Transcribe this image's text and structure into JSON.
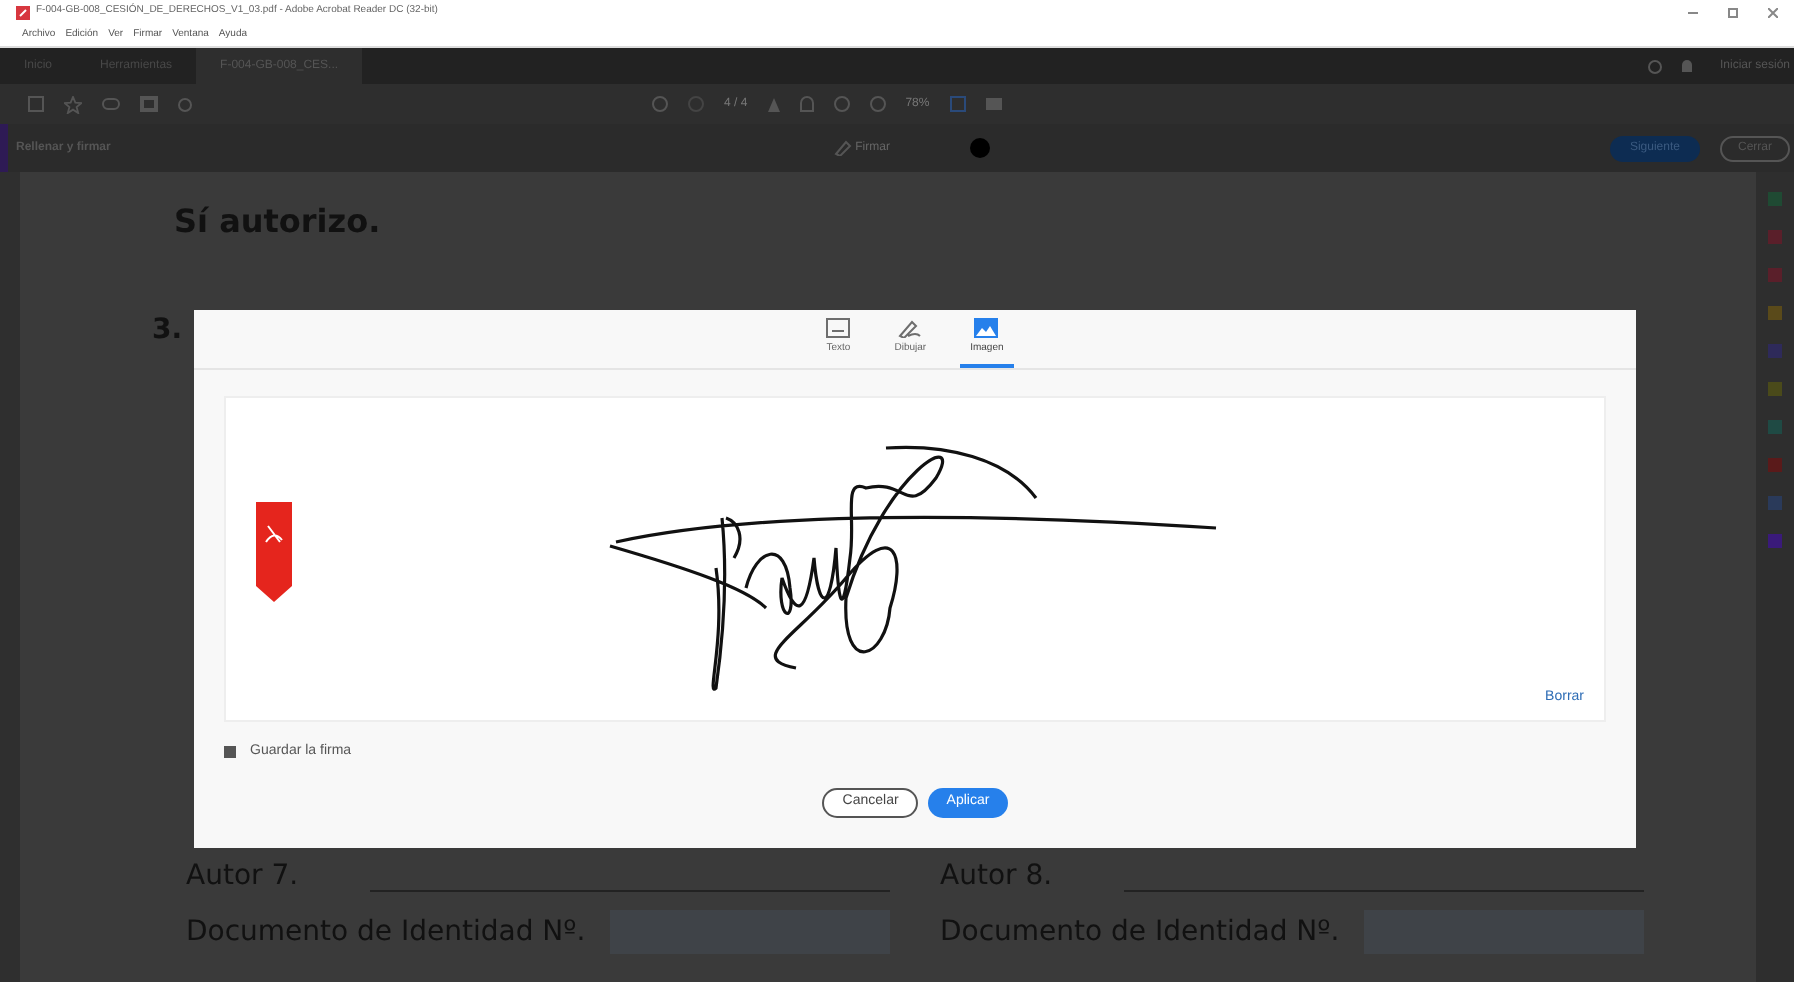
{
  "window": {
    "title": "F-004-GB-008_CESIÓN_DE_DERECHOS_V1_03.pdf - Adobe Acrobat Reader DC (32-bit)"
  },
  "menu": [
    "Archivo",
    "Edición",
    "Ver",
    "Firmar",
    "Ventana",
    "Ayuda"
  ],
  "tabs": [
    {
      "label": "Inicio",
      "selected": false
    },
    {
      "label": "Herramientas",
      "selected": false
    },
    {
      "label": "F-004-GB-008_CES...",
      "selected": true
    }
  ],
  "account": {
    "label": "Iniciar sesión"
  },
  "toolbar": {
    "page": "4 / 4",
    "zoom": "78%"
  },
  "sign_bar": {
    "title": "Rellenar y firmar",
    "sign": "Firmar",
    "next": "Siguiente",
    "close": "Cerrar"
  },
  "document": {
    "heading": "Sí autorizo.",
    "item_number": "3.",
    "authors": [
      {
        "label": "Autor 7.",
        "id_label": "Documento de Identidad Nº."
      },
      {
        "label": "Autor 8.",
        "id_label": "Documento de Identidad Nº."
      }
    ]
  },
  "dialog": {
    "tabs": [
      {
        "label": "Texto",
        "kind": "text",
        "selected": false
      },
      {
        "label": "Dibujar",
        "kind": "draw",
        "selected": false
      },
      {
        "label": "Imagen",
        "kind": "image",
        "selected": true
      }
    ],
    "clear": "Borrar",
    "save": {
      "label": "Guardar la firma",
      "checked": true
    },
    "buttons": [
      {
        "label": "Cancelar",
        "kind": "secondary"
      },
      {
        "label": "Aplicar",
        "kind": "primary"
      }
    ]
  }
}
